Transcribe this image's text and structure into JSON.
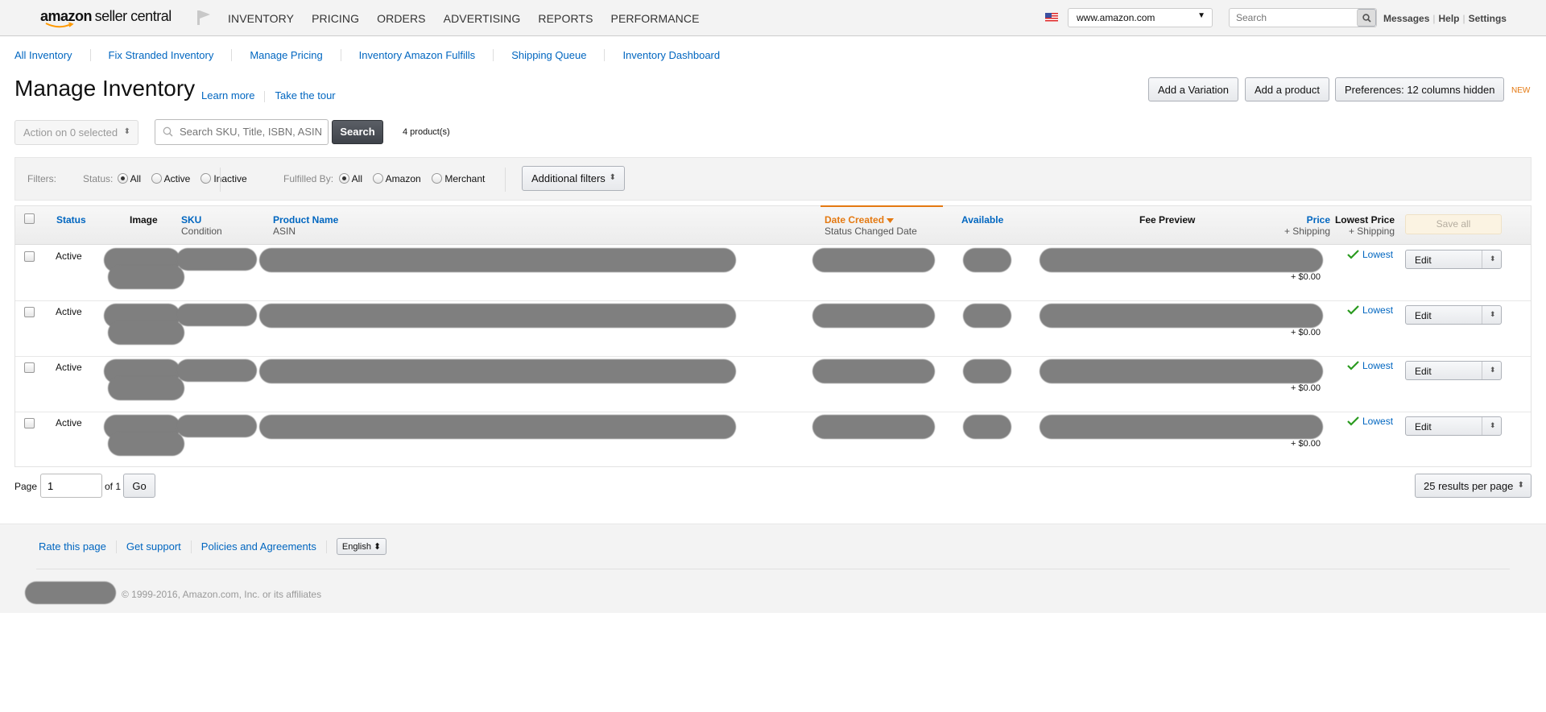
{
  "header": {
    "logo_brand": "amazon",
    "logo_product": "seller central",
    "nav": [
      "INVENTORY",
      "PRICING",
      "ORDERS",
      "ADVERTISING",
      "REPORTS",
      "PERFORMANCE"
    ],
    "marketplace": "www.amazon.com",
    "search_placeholder": "Search",
    "links": [
      "Messages",
      "Help",
      "Settings"
    ]
  },
  "subnav": [
    "All Inventory",
    "Fix Stranded Inventory",
    "Manage Pricing",
    "Inventory Amazon Fulfills",
    "Shipping Queue",
    "Inventory Dashboard"
  ],
  "page": {
    "title": "Manage Inventory",
    "learn_more": "Learn more",
    "take_tour": "Take the tour",
    "add_variation": "Add a Variation",
    "add_product": "Add a product",
    "preferences": "Preferences: 12 columns hidden",
    "new_badge": "NEW"
  },
  "controls": {
    "action_select": "Action on 0 selected",
    "sku_search_placeholder": "Search SKU, Title, ISBN, ASIN",
    "search_button": "Search",
    "product_count": "4 product(s)"
  },
  "filters": {
    "label": "Filters:",
    "status_label": "Status:",
    "status_options": [
      "All",
      "Active",
      "Inactive"
    ],
    "status_selected": "All",
    "fulfilled_label": "Fulfilled By:",
    "fulfilled_options": [
      "All",
      "Amazon",
      "Merchant"
    ],
    "fulfilled_selected": "All",
    "additional": "Additional filters"
  },
  "table": {
    "columns": {
      "status": "Status",
      "image": "Image",
      "sku": "SKU",
      "sku_sub": "Condition",
      "product_name": "Product Name",
      "product_name_sub": "ASIN",
      "date_created": "Date Created",
      "date_created_sub": "Status Changed Date",
      "available": "Available",
      "fee_preview": "Fee Preview",
      "price": "Price",
      "price_sub": "+ Shipping",
      "lowest_price": "Lowest Price",
      "lowest_price_sub": "+ Shipping",
      "save_all": "Save all"
    },
    "rows": [
      {
        "status": "Active",
        "shipping": "+ $0.00",
        "lowest": "Lowest",
        "action": "Edit"
      },
      {
        "status": "Active",
        "shipping": "+ $0.00",
        "lowest": "Lowest",
        "action": "Edit"
      },
      {
        "status": "Active",
        "shipping": "+ $0.00",
        "lowest": "Lowest",
        "action": "Edit"
      },
      {
        "status": "Active",
        "shipping": "+ $0.00",
        "lowest": "Lowest",
        "action": "Edit"
      }
    ]
  },
  "pagination": {
    "page_label": "Page",
    "page_value": "1",
    "of_label": "of 1",
    "go": "Go",
    "per_page": "25 results per page"
  },
  "footer": {
    "links": [
      "Rate this page",
      "Get support",
      "Policies and Agreements"
    ],
    "language": "English",
    "copyright": "© 1999-2016, Amazon.com, Inc. or its affiliates"
  },
  "colors": {
    "link": "#0066c0",
    "accent_orange": "#e47911",
    "check_green": "#2a9a1f",
    "search_button": "#4a4e55"
  }
}
